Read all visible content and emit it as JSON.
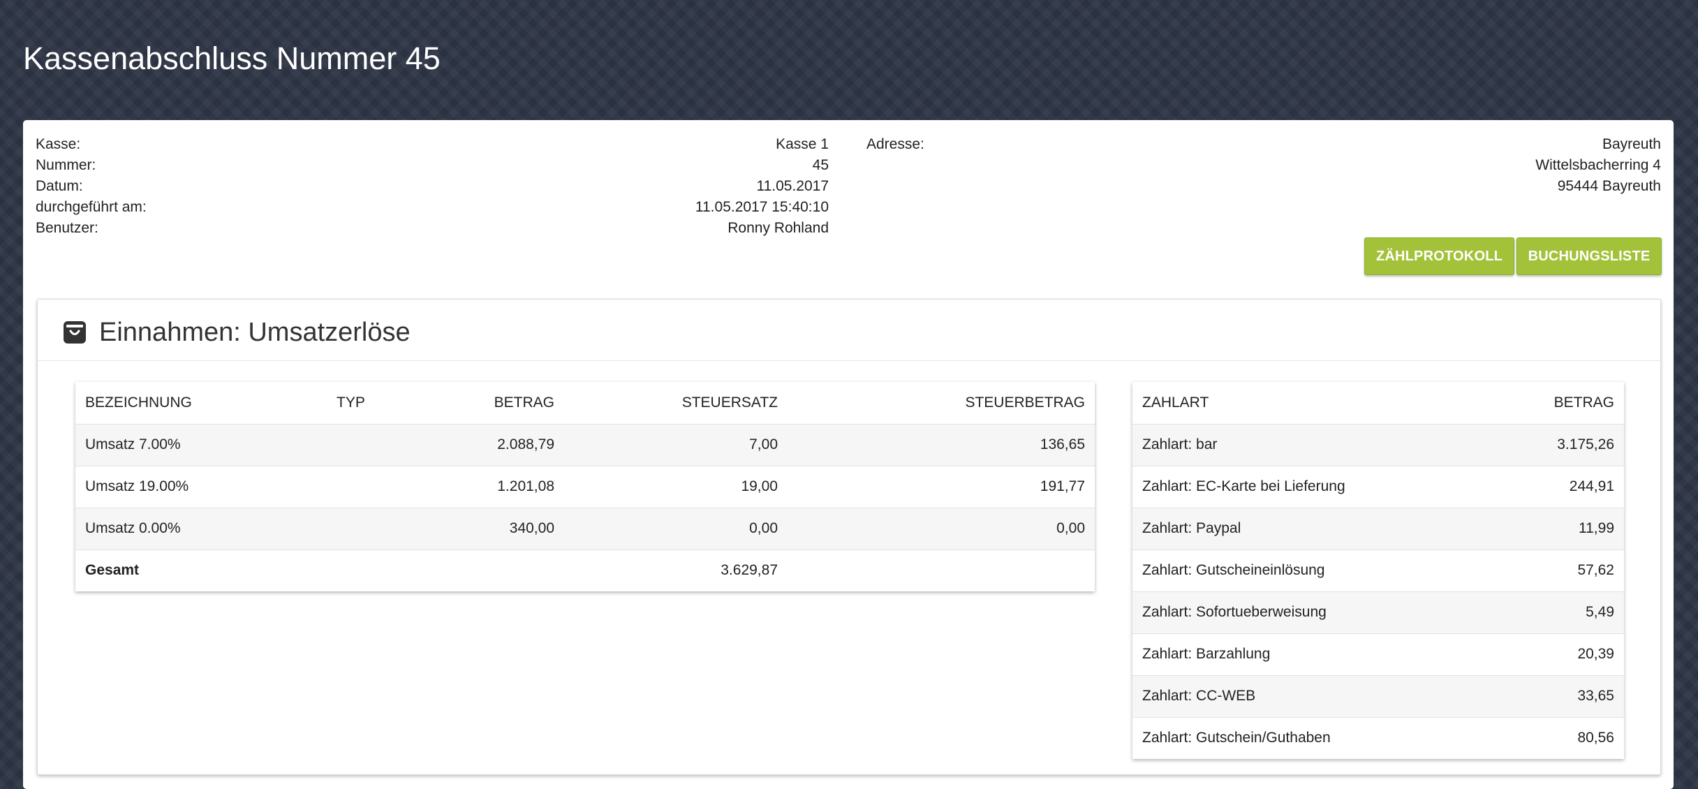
{
  "page": {
    "title": "Kassenabschluss Nummer 45"
  },
  "info_left": [
    {
      "label": "Kasse:",
      "value": "Kasse 1"
    },
    {
      "label": "Nummer:",
      "value": "45"
    },
    {
      "label": "Datum:",
      "value": "11.05.2017"
    },
    {
      "label": "durchgeführt am:",
      "value": "11.05.2017 15:40:10"
    },
    {
      "label": "Benutzer:",
      "value": "Ronny Rohland"
    }
  ],
  "info_right": {
    "label": "Adresse:",
    "lines": [
      "Bayreuth",
      "Wittelsbacherring 4",
      "95444 Bayreuth"
    ]
  },
  "buttons": {
    "zaehlprotokoll": "ZÄHLPROTOKOLL",
    "buchungsliste": "BUCHUNGSLISTE"
  },
  "section": {
    "title": "Einnahmen: Umsatzerlöse",
    "icon": "shopping-bag-icon"
  },
  "revenue_table": {
    "headers": [
      "BEZEICHNUNG",
      "TYP",
      "BETRAG",
      "STEUERSATZ",
      "STEUERBETRAG"
    ],
    "rows": [
      {
        "bezeichnung": "Umsatz 7.00%",
        "typ": "",
        "betrag": "2.088,79",
        "steuersatz": "7,00",
        "steuerbetrag": "136,65"
      },
      {
        "bezeichnung": "Umsatz 19.00%",
        "typ": "",
        "betrag": "1.201,08",
        "steuersatz": "19,00",
        "steuerbetrag": "191,77"
      },
      {
        "bezeichnung": "Umsatz 0.00%",
        "typ": "",
        "betrag": "340,00",
        "steuersatz": "0,00",
        "steuerbetrag": "0,00"
      }
    ],
    "total": {
      "label": "Gesamt",
      "value": "3.629,87"
    }
  },
  "payment_table": {
    "headers": [
      "ZAHLART",
      "BETRAG"
    ],
    "rows": [
      {
        "zahlart": "Zahlart: bar",
        "betrag": "3.175,26"
      },
      {
        "zahlart": "Zahlart: EC-Karte bei Lieferung",
        "betrag": "244,91"
      },
      {
        "zahlart": "Zahlart: Paypal",
        "betrag": "11,99"
      },
      {
        "zahlart": "Zahlart: Gutscheineinlösung",
        "betrag": "57,62"
      },
      {
        "zahlart": "Zahlart: Sofortueberweisung",
        "betrag": "5,49"
      },
      {
        "zahlart": "Zahlart: Barzahlung",
        "betrag": "20,39"
      },
      {
        "zahlart": "Zahlart: CC-WEB",
        "betrag": "33,65"
      },
      {
        "zahlart": "Zahlart: Gutschein/Guthaben",
        "betrag": "80,56"
      }
    ]
  },
  "colors": {
    "accent": "#a3c23a",
    "background": "#2e3545"
  }
}
